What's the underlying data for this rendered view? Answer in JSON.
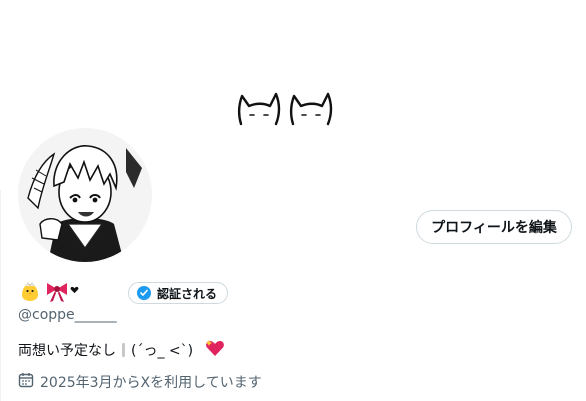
{
  "profile": {
    "edit_profile_label": "プロフィールを編集",
    "name_emojis": [
      "chick-emoji",
      "ribbon-emoji"
    ],
    "verify_label": "認証される",
    "handle": "@coppe______",
    "bio_text": "両想い予定なし",
    "bio_kaomoji": "(´っ_ <`)",
    "joined_text": "2025年3月からXを利用しています"
  },
  "icons": {
    "banner": "cat-faces-drawing",
    "avatar": "manga-boy-avatar",
    "verified": "verified-check-icon",
    "calendar": "calendar-icon",
    "heart": "sparkling-heart-emoji"
  },
  "colors": {
    "accent": "#1d9bf0",
    "text": "#0f1419",
    "secondary": "#536471",
    "border": "#cfd9de"
  }
}
